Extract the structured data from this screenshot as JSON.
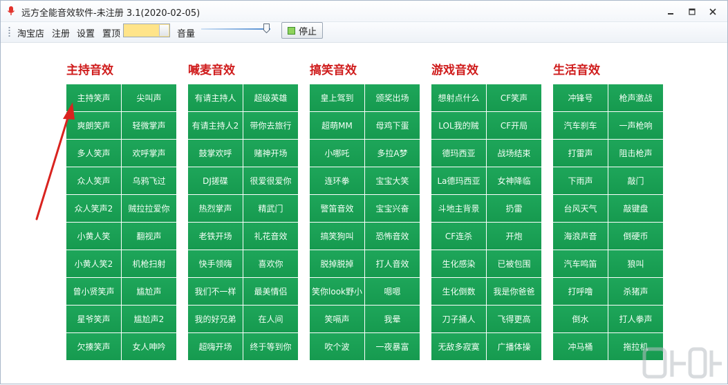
{
  "window": {
    "title": "远方全能音效软件-未注册 3.1(2020-02-05)"
  },
  "toolbar": {
    "menu": [
      "淘宝店",
      "注册",
      "设置",
      "置顶"
    ],
    "topmost_color": "#ffe48a",
    "volume_label": "音量",
    "volume_level": 0.95,
    "stop_label": "停止"
  },
  "groups": [
    {
      "title": "主持音效",
      "items": [
        "主持笑声",
        "尖叫声",
        "爽朗笑声",
        "轻微掌声",
        "多人笑声",
        "欢呼掌声",
        "众人笑声",
        "乌鸦飞过",
        "众人笑声2",
        "贼拉拉爱你",
        "小黄人笑",
        "翻视声",
        "小黄人笑2",
        "机枪扫射",
        "曾小贤笑声",
        "尴尬声",
        "星爷笑声",
        "尴尬声2",
        "欠揍笑声",
        "女人呻吟"
      ]
    },
    {
      "title": "喊麦音效",
      "items": [
        "有请主持人",
        "超级英雄",
        "有请主持人2",
        "带你去旅行",
        "鼓掌欢呼",
        "赌神开场",
        "DJ搓碟",
        "很爱很爱你",
        "热烈掌声",
        "精武门",
        "老铁开场",
        "礼花音效",
        "快手领嗨",
        "喜欢你",
        "我们不一样",
        "最美情侣",
        "我的好兄弟",
        "在人间",
        "超嗨开场",
        "终于等到你"
      ]
    },
    {
      "title": "搞笑音效",
      "items": [
        "皇上驾到",
        "颁奖出场",
        "超萌MM",
        "母鸡下蛋",
        "小哪吒",
        "多拉A梦",
        "连环拳",
        "宝宝大笑",
        "警笛音效",
        "宝宝兴奋",
        "搞笑狗叫",
        "恐怖音效",
        "脱掉脱掉",
        "打人音效",
        "笑你look野小",
        "嗯嗯",
        "笑嗝声",
        "我晕",
        "吹个波",
        "一夜暴富"
      ]
    },
    {
      "title": "游戏音效",
      "items": [
        "想射点什么",
        "CF笑声",
        "LOL我的贼",
        "CF开局",
        "德玛西亚",
        "战场结束",
        "La德玛西亚",
        "女神降临",
        "斗地主背景",
        "扔雷",
        "CF连杀",
        "开炮",
        "生化感染",
        "已被包围",
        "生化倒数",
        "我是你爸爸",
        "刀子捅人",
        "飞得更高",
        "无敌多寂寞",
        "广播体操"
      ]
    },
    {
      "title": "生活音效",
      "items": [
        "冲锋号",
        "枪声激战",
        "汽车刹车",
        "一声枪响",
        "打雷声",
        "阻击枪声",
        "下雨声",
        "敲门",
        "台风天气",
        "敲键盘",
        "海浪声音",
        "倒硬币",
        "汽车鸣笛",
        "狼叫",
        "打呼噜",
        "杀猪声",
        "倒水",
        "打人拳声",
        "冲马桶",
        "拖拉机"
      ]
    }
  ],
  "colors": {
    "button_green": "#1ea65a",
    "group_title_red": "#cf1b1b",
    "arrow_red": "#d9231f"
  },
  "icons": {
    "app": "microphone-icon",
    "minimize": "minimize-icon",
    "maximize": "maximize-icon",
    "close": "close-icon"
  }
}
